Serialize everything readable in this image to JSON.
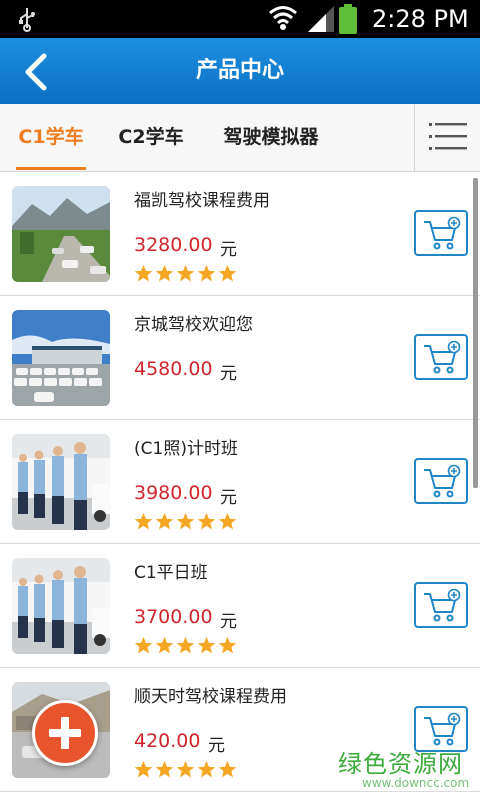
{
  "status_bar": {
    "time": "2:28 PM"
  },
  "header": {
    "title": "产品中心"
  },
  "tabs": [
    {
      "label": "C1学车",
      "active": true
    },
    {
      "label": "C2学车",
      "active": false
    },
    {
      "label": "驾驶模拟器",
      "active": false
    }
  ],
  "products": [
    {
      "name": "福凯驾校课程费用",
      "price": "3280.00",
      "unit": "元",
      "rating": 5,
      "thumb": "mountain-road-cars"
    },
    {
      "name": "京城驾校欢迎您",
      "price": "4580.00",
      "unit": "元",
      "rating": null,
      "thumb": "parking-lot-cars"
    },
    {
      "name": "(C1照)计时班",
      "price": "3980.00",
      "unit": "元",
      "rating": 5,
      "thumb": "instructors-lineup"
    },
    {
      "name": "C1平日班",
      "price": "3700.00",
      "unit": "元",
      "rating": 5,
      "thumb": "instructors-lineup"
    },
    {
      "name": "顺天时驾校课程费用",
      "price": "420.00",
      "unit": "元",
      "rating": 5,
      "thumb": "hillside-cars"
    }
  ],
  "watermark": {
    "main": "绿色资源网",
    "url": "www.downcc.com"
  },
  "colors": {
    "accent": "#ee7d1e",
    "header_blue": "#1a85d6",
    "price_red": "#d0262b",
    "star_orange": "#f5a623",
    "fab_orange": "#e8552c"
  }
}
